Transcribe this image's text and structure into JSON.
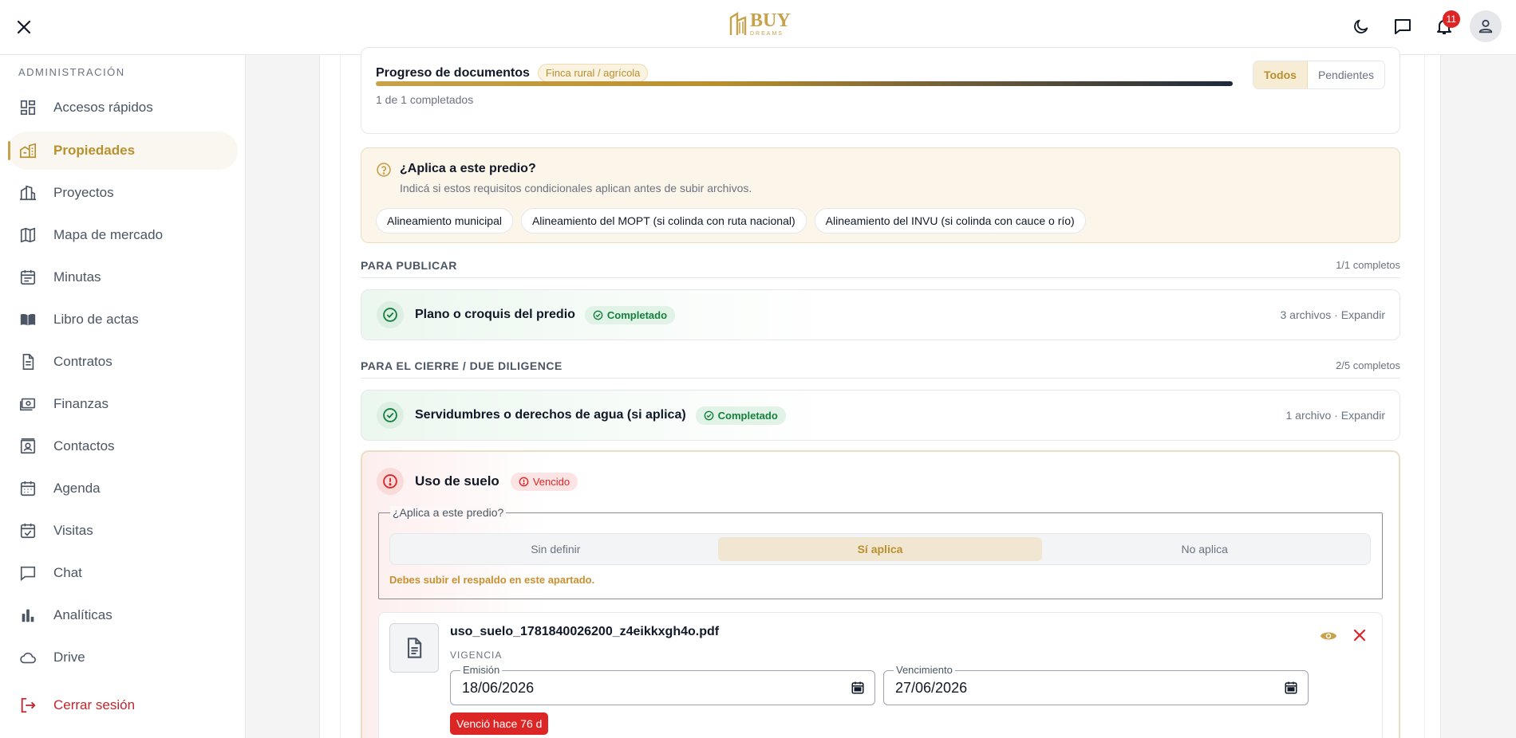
{
  "header": {
    "logo_main": "BUY",
    "logo_sub": "DREAMS",
    "notifications_count": "11"
  },
  "sidebar": {
    "section_label": "ADMINISTRACIÓN",
    "items": [
      {
        "label": "Accesos rápidos",
        "icon": "dashboard-icon"
      },
      {
        "label": "Propiedades",
        "icon": "buildings-icon",
        "active": true
      },
      {
        "label": "Proyectos",
        "icon": "project-buildings-icon"
      },
      {
        "label": "Mapa de mercado",
        "icon": "map-icon"
      },
      {
        "label": "Minutas",
        "icon": "calendar-list-icon"
      },
      {
        "label": "Libro de actas",
        "icon": "book-icon"
      },
      {
        "label": "Contratos",
        "icon": "document-icon"
      },
      {
        "label": "Finanzas",
        "icon": "money-icon"
      },
      {
        "label": "Contactos",
        "icon": "contact-card-icon"
      },
      {
        "label": "Agenda",
        "icon": "calendar-icon"
      },
      {
        "label": "Visitas",
        "icon": "calendar-check-icon"
      },
      {
        "label": "Chat",
        "icon": "chat-icon"
      },
      {
        "label": "Analíticas",
        "icon": "bar-chart-icon"
      },
      {
        "label": "Drive",
        "icon": "cloud-icon"
      }
    ],
    "logout_label": "Cerrar sesión"
  },
  "progress": {
    "title": "Progreso de documentos",
    "tag": "Finca rural / agrícola",
    "completed_text": "1 de 1 completados",
    "filter_all": "Todos",
    "filter_pending": "Pendientes",
    "fraction": 1.0
  },
  "conditional": {
    "title": "¿Aplica a este predio?",
    "subtitle": "Indicá si estos requisitos condicionales aplican antes de subir archivos.",
    "chips": [
      "Alineamiento municipal",
      "Alineamiento del MOPT (si colinda con ruta nacional)",
      "Alineamiento del INVU (si colinda con cauce o río)"
    ]
  },
  "publish_section": {
    "title": "PARA PUBLICAR",
    "count": "1/1 completos",
    "doc_name": "Plano o croquis del predio",
    "status": "Completado",
    "meta": "3 archivos · Expandir"
  },
  "closing_section": {
    "title": "PARA EL CIERRE / DUE DILIGENCE",
    "count": "2/5 completos",
    "doc_name": "Servidumbres o derechos de agua (si aplica)",
    "status": "Completado",
    "meta": "1 archivo · Expandir"
  },
  "expired_doc": {
    "name": "Uso de suelo",
    "status": "Vencido",
    "question": "¿Aplica a este predio?",
    "options": [
      "Sin definir",
      "Sí aplica",
      "No aplica"
    ],
    "selected_option": "Sí aplica",
    "warning": "Debes subir el respaldo en este apartado.",
    "file_name": "uso_suelo_1781840026200_z4eikkxgh4o.pdf",
    "validity_label": "VIGENCIA",
    "issue_label": "Emisión",
    "issue_date": "18/06/2026",
    "expiry_label": "Vencimiento",
    "expiry_date": "27/06/2026",
    "expired_badge": "Venció hace 76 d"
  },
  "colors": {
    "accent": "#c8a24a",
    "success": "#15803d",
    "danger": "#dc2626"
  }
}
